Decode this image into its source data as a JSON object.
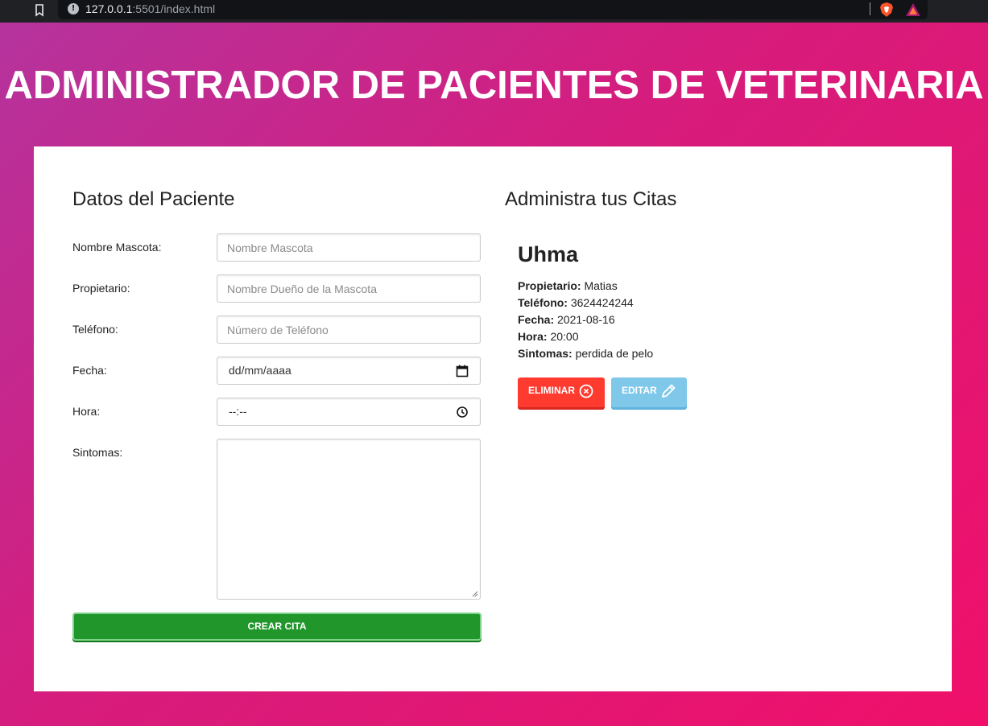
{
  "browser": {
    "url_host": "127.0.0.1",
    "url_rest": ":5501/index.html"
  },
  "page": {
    "title": "ADMINISTRADOR DE PACIENTES DE VETERINARIA"
  },
  "form": {
    "title": "Datos del Paciente",
    "fields": [
      {
        "label": "Nombre Mascota:",
        "placeholder": "Nombre Mascota"
      },
      {
        "label": "Propietario:",
        "placeholder": "Nombre Dueño de la Mascota"
      },
      {
        "label": "Teléfono:",
        "placeholder": "Número de Teléfono"
      },
      {
        "label": "Fecha:",
        "value": "dd/mm/aaaa"
      },
      {
        "label": "Hora:",
        "value": "--:--"
      },
      {
        "label": "Sintomas:"
      }
    ],
    "submit_label": "CREAR CITA"
  },
  "appointments": {
    "title": "Administra tus Citas",
    "items": [
      {
        "name": "Uhma",
        "owner_label": "Propietario:",
        "owner": "Matias",
        "phone_label": "Teléfono:",
        "phone": "3624424244",
        "date_label": "Fecha:",
        "date": "2021-08-16",
        "time_label": "Hora:",
        "time": "20:00",
        "symptoms_label": "Sintomas:",
        "symptoms": "perdida de pelo",
        "delete_label": "ELIMINAR",
        "edit_label": "EDITAR"
      }
    ]
  },
  "colors": {
    "gradient_start": "#b4349e",
    "gradient_end": "#f0106a",
    "submit": "#21962b",
    "delete": "#ff3b30",
    "edit": "#7fc8ea"
  },
  "icons": [
    "bookmark-icon",
    "info-icon",
    "brave-icon",
    "rewards-icon",
    "calendar-icon",
    "clock-icon",
    "close-circle-icon",
    "pencil-icon"
  ]
}
